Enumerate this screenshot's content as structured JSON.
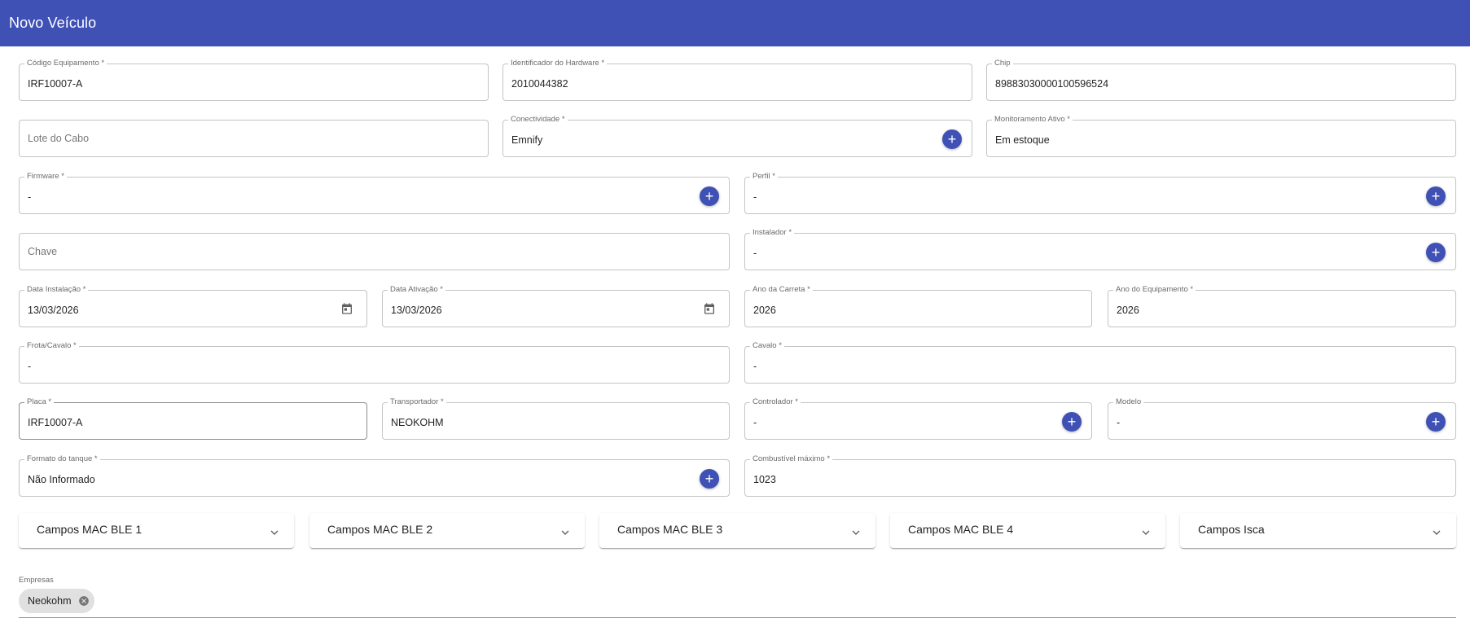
{
  "header": {
    "title": "Novo Veículo"
  },
  "fields": {
    "codigo_equipamento": {
      "label": "Código Equipamento *",
      "value": "IRF10007-A"
    },
    "identificador_hardware": {
      "label": "Identificador do Hardware *",
      "value": "2010044382"
    },
    "chip": {
      "label": "Chip",
      "value": "89883030000100596524"
    },
    "lote_cabo": {
      "placeholder": "Lote do Cabo"
    },
    "conectividade": {
      "label": "Conectividade *",
      "value": "Emnify"
    },
    "monitoramento_ativo": {
      "label": "Monitoramento Ativo *",
      "value": "Em estoque"
    },
    "firmware": {
      "label": "Firmware *",
      "value": "-"
    },
    "perfil": {
      "label": "Perfil *",
      "value": "-"
    },
    "chave": {
      "placeholder": "Chave"
    },
    "instalador": {
      "label": "Instalador *",
      "value": "-"
    },
    "data_instalacao": {
      "label": "Data Instalação *",
      "value": "13/03/2026"
    },
    "data_ativacao": {
      "label": "Data Ativação *",
      "value": "13/03/2026"
    },
    "ano_carreta": {
      "label": "Ano da Carreta *",
      "value": "2026"
    },
    "ano_equipamento": {
      "label": "Ano do Equipamento *",
      "value": "2026"
    },
    "frota_cavalo": {
      "label": "Frota/Cavalo *",
      "value": "-"
    },
    "cavalo": {
      "label": "Cavalo *",
      "value": "-"
    },
    "placa": {
      "label": "Placa *",
      "value": "IRF10007-A"
    },
    "transportador": {
      "label": "Transportador *",
      "value": "NEOKOHM"
    },
    "controlador": {
      "label": "Controlador *",
      "value": "-"
    },
    "modelo": {
      "label": "Modelo",
      "value": "-"
    },
    "formato_tanque": {
      "label": "Formato do tanque *",
      "value": "Não Informado"
    },
    "combustivel_maximo": {
      "label": "Combustível máximo *",
      "value": "1023"
    }
  },
  "accordions": [
    {
      "label": "Campos MAC BLE 1"
    },
    {
      "label": "Campos MAC BLE 2"
    },
    {
      "label": "Campos MAC BLE 3"
    },
    {
      "label": "Campos MAC BLE 4"
    },
    {
      "label": "Campos Isca"
    }
  ],
  "empresas": {
    "label": "Empresas",
    "chips": [
      {
        "label": "Neokohm"
      }
    ]
  },
  "icons": {
    "add": "plus-icon",
    "calendar": "calendar-icon",
    "expand": "chevron-down-icon",
    "remove": "cancel-circle-icon"
  },
  "colors": {
    "primary": "#3f51b5",
    "chip_bg": "#e0e0e0"
  }
}
